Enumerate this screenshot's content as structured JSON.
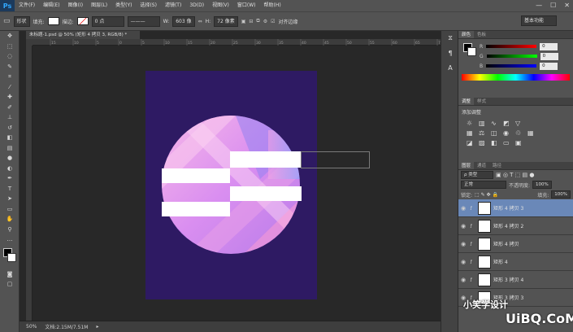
{
  "app": {
    "logo": "Ps"
  },
  "menu": [
    "文件(F)",
    "编辑(E)",
    "图像(I)",
    "图层(L)",
    "类型(Y)",
    "选择(S)",
    "滤镜(T)",
    "3D(D)",
    "视图(V)",
    "窗口(W)",
    "帮助(H)"
  ],
  "window_controls": [
    "—",
    "☐",
    "✕"
  ],
  "options": {
    "shape_mode": "形状",
    "fill_label": "填充:",
    "stroke_label": "描边:",
    "stroke_width": "0 点",
    "w_label": "W:",
    "w_value": "603 像",
    "h_label": "H:",
    "h_value": "72 像素",
    "align_edges": "对齐边缘",
    "workspace": "基本功能"
  },
  "document": {
    "tab_title": "未标题-1.psd @ 50% (矩形 4 拷贝 3, RGB/8) *",
    "zoom": "50%",
    "doc_size": "文档:2.15M/7.51M",
    "ruler_numbers": [
      "15",
      "10",
      "5",
      "0",
      "5",
      "10",
      "15",
      "20",
      "25",
      "30",
      "35",
      "40",
      "45",
      "50",
      "55",
      "60",
      "65",
      "70"
    ]
  },
  "panels": {
    "color_tabs": [
      "颜色",
      "色板"
    ],
    "color": {
      "r_label": "R",
      "g_label": "G",
      "b_label": "B",
      "r": "0",
      "g": "0",
      "b": "0"
    },
    "adjust_tabs": [
      "调整",
      "样式"
    ],
    "adjust_title": "添加调整",
    "layer_tabs": [
      "图层",
      "通道",
      "路径"
    ],
    "kind_filter": "ρ 类型",
    "blend_mode": "正常",
    "opacity_label": "不透明度:",
    "opacity": "100%",
    "lock_label": "锁定:",
    "fill_label": "填充:",
    "fill": "100%",
    "layers": [
      {
        "name": "矩形 4 拷贝 3",
        "selected": true
      },
      {
        "name": "矩形 4 拷贝 2",
        "selected": false
      },
      {
        "name": "矩形 4 拷贝",
        "selected": false
      },
      {
        "name": "矩形 4",
        "selected": false
      },
      {
        "name": "矩形 3 拷贝 4",
        "selected": false
      },
      {
        "name": "矩形 3 拷贝 3",
        "selected": false
      }
    ]
  },
  "watermark": {
    "text": "小笑学设计",
    "site": "UiBQ.CoM"
  },
  "colors": {
    "artboard": "#2e1a63",
    "layer_selected": "#6a88b8",
    "accent": "#31a8ff"
  }
}
